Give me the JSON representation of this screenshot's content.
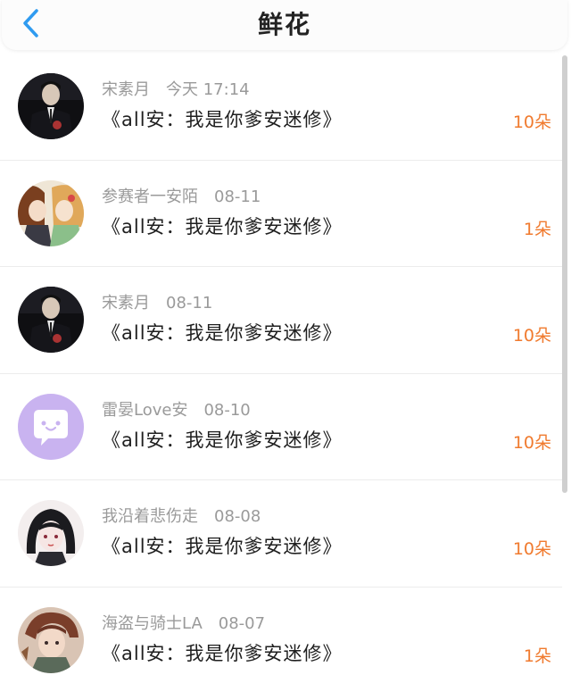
{
  "header": {
    "title": "鲜花",
    "back_icon": "chevron-left-icon",
    "accent_color": "#2f9bf0"
  },
  "flower_color": "#f07a2e",
  "records": [
    {
      "user": "宋素月",
      "date": "今天 17:14",
      "book": "《all安：我是你爹安迷修》",
      "count": "10朵",
      "avatar": "man-in-suit-avatar"
    },
    {
      "user": "参赛者一安陌",
      "date": "08-11",
      "book": "《all安：我是你爹安迷修》",
      "count": "1朵",
      "avatar": "anime-couple-avatar"
    },
    {
      "user": "宋素月",
      "date": "08-11",
      "book": "《all安：我是你爹安迷修》",
      "count": "10朵",
      "avatar": "man-in-suit-avatar"
    },
    {
      "user": "雷晏Love安",
      "date": "08-10",
      "book": "《all安：我是你爹安迷修》",
      "count": "10朵",
      "avatar": "chat-bubble-avatar"
    },
    {
      "user": "我沿着悲伤走",
      "date": "08-08",
      "book": "《all安：我是你爹安迷修》",
      "count": "10朵",
      "avatar": "anime-girl-avatar"
    },
    {
      "user": "海盗与骑士LA",
      "date": "08-07",
      "book": "《all安：我是你爹安迷修》",
      "count": "1朵",
      "avatar": "anime-pirate-avatar"
    }
  ]
}
